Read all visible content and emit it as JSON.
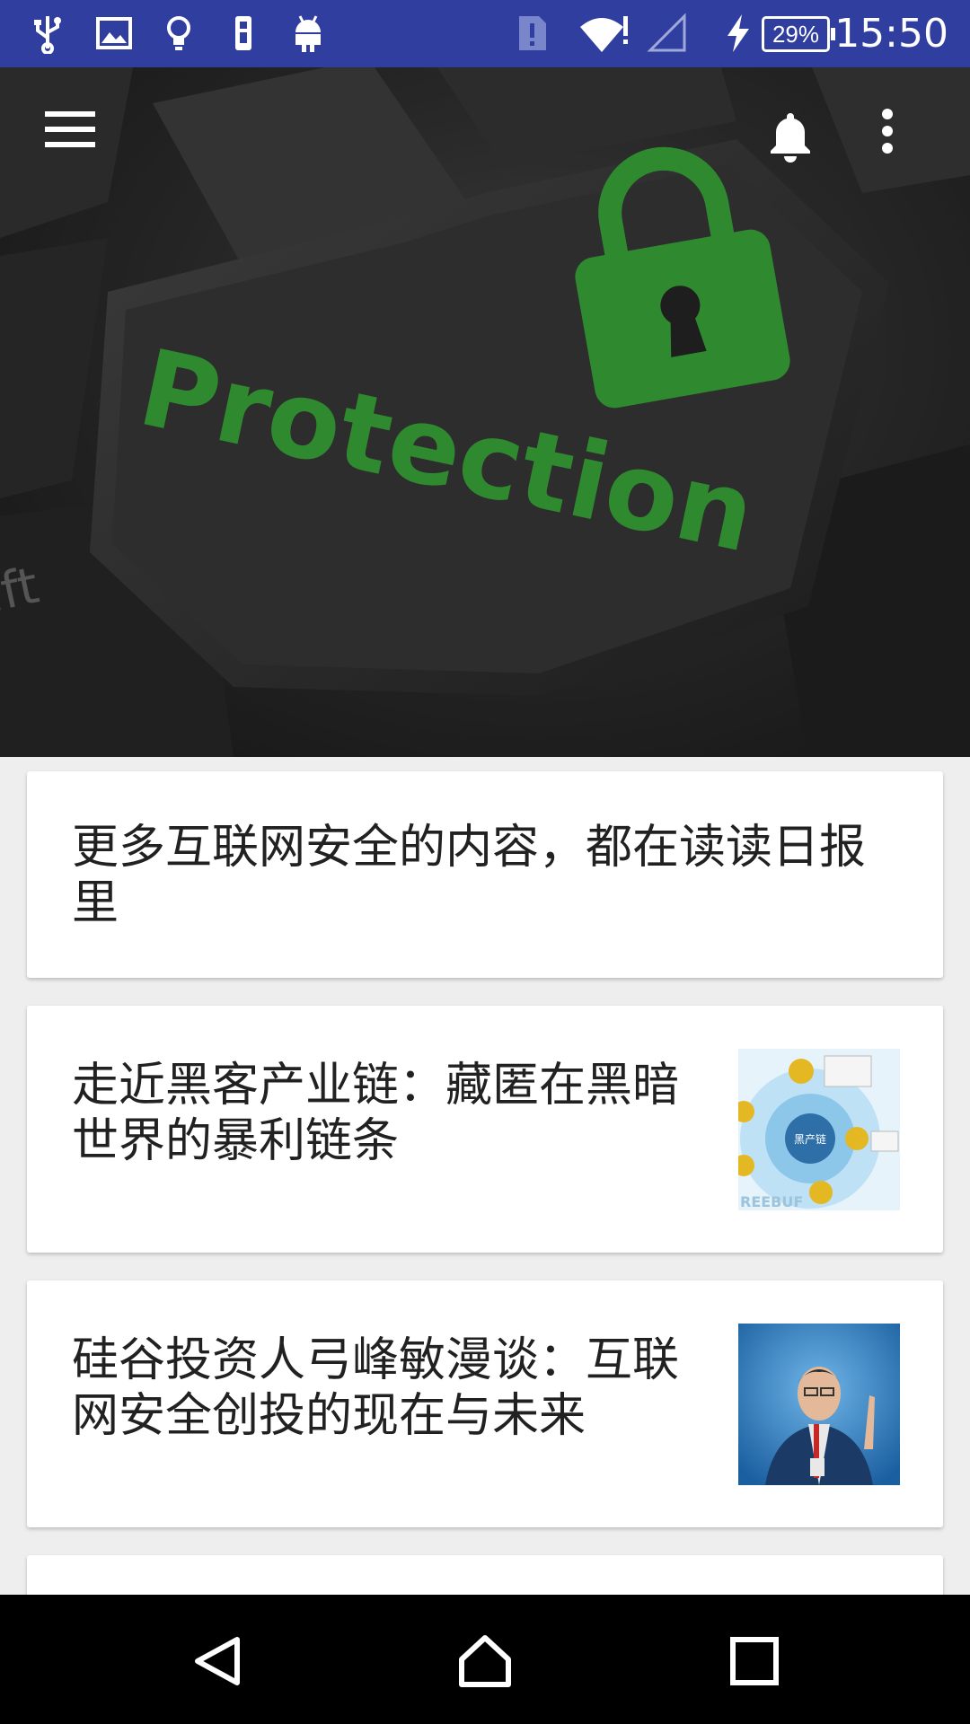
{
  "status_bar": {
    "time": "15:50",
    "battery_percent": "29%",
    "icons": [
      "usb-icon",
      "image-icon",
      "lightbulb-icon",
      "sim-icon",
      "android-icon",
      "alert-icon",
      "wifi-icon",
      "signal-icon",
      "charging-icon",
      "battery-icon"
    ]
  },
  "header": {
    "image_text": "Protection",
    "keycap_text": "ift",
    "menu_icon": "menu-icon",
    "notification_icon": "bell-icon",
    "more_icon": "more-vert-icon"
  },
  "articles": [
    {
      "title": "更多互联网安全的内容，都在读读日报里",
      "has_thumbnail": false
    },
    {
      "title": "走近黑客产业链：藏匿在黑暗世界的暴利链条",
      "has_thumbnail": true,
      "thumbnail": {
        "center_label": "黑产链",
        "watermark": "REEBUF"
      }
    },
    {
      "title": "硅谷投资人弓峰敏漫谈：互联网安全创投的现在与未来",
      "has_thumbnail": true
    }
  ],
  "nav_bar": {
    "back_icon": "back-icon",
    "home_icon": "home-icon",
    "recents_icon": "recents-icon"
  },
  "colors": {
    "status_bar": "#303f9f",
    "accent_green": "#2f8a2f",
    "background": "#eeeeee"
  }
}
